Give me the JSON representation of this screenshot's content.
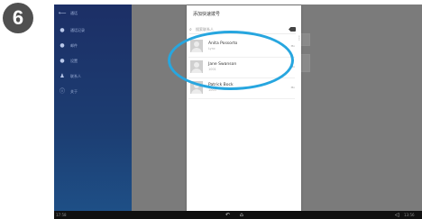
{
  "step_badge": "6",
  "sidebar": {
    "items": [
      {
        "icon": "back-arrow-icon",
        "label": "通话"
      },
      {
        "icon": "dot-icon",
        "label": "通话记录"
      },
      {
        "icon": "dot-icon",
        "label": "邮件"
      },
      {
        "icon": "dot-icon",
        "label": "设置"
      },
      {
        "icon": "person-icon",
        "label": "联系人"
      },
      {
        "icon": "info-icon",
        "label": "关于"
      }
    ]
  },
  "dialog": {
    "title": "添加快速拨号",
    "search_placeholder": "搜索联系人",
    "contacts": [
      {
        "name": "Anita Possorto",
        "sub": "Lync",
        "tag": "Mo"
      },
      {
        "name": "Jane Swanson",
        "sub": "1001",
        "tag": "Mo"
      },
      {
        "name": "Patrick Bock",
        "sub": "1003",
        "tag": "Mo"
      }
    ]
  },
  "navbar": {
    "left_text": "17:58",
    "right_text": "13:56"
  }
}
